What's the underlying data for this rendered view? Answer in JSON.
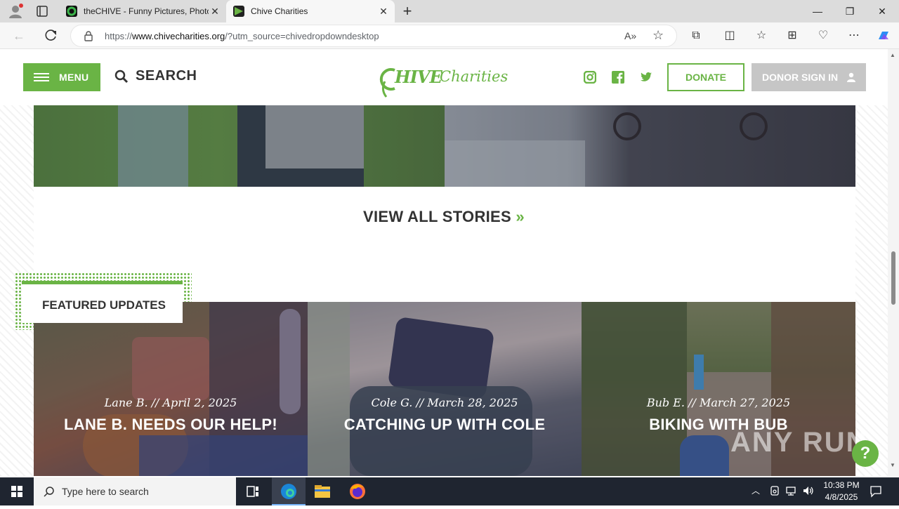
{
  "browser": {
    "tabs": [
      {
        "title": "theCHIVE - Funny Pictures, Photo",
        "active": false
      },
      {
        "title": "Chive Charities",
        "active": true
      }
    ],
    "url_prefix": "https://",
    "url_domain": "www.chivecharities.org",
    "url_path": "/?utm_source=chivedropdowndesktop"
  },
  "header": {
    "menu_label": "MENU",
    "search_label": "SEARCH",
    "logo_text_a": "HIVE",
    "logo_text_b": "Charities",
    "donate_label": "DONATE",
    "donor_signin_label": "DONOR SIGN IN"
  },
  "stories": {
    "view_all_label": "VIEW ALL STORIES",
    "view_all_glyph": "»"
  },
  "featured": {
    "section_label": "FEATURED UPDATES",
    "cards": [
      {
        "meta": "Lane B. // April 2, 2025",
        "title": "LANE B. NEEDS OUR HELP!"
      },
      {
        "meta": "Cole G. // March 28, 2025",
        "title": "CATCHING UP WITH COLE"
      },
      {
        "meta": "Bub E. // March 27, 2025",
        "title": "BIKING WITH BUB"
      }
    ]
  },
  "help_label": "?",
  "watermark_text": "ANY RUN",
  "taskbar": {
    "search_placeholder": "Type here to search",
    "time": "10:38 PM",
    "date": "4/8/2025"
  },
  "colors": {
    "brand_green": "#6ab445",
    "taskbar": "#1f2530"
  }
}
